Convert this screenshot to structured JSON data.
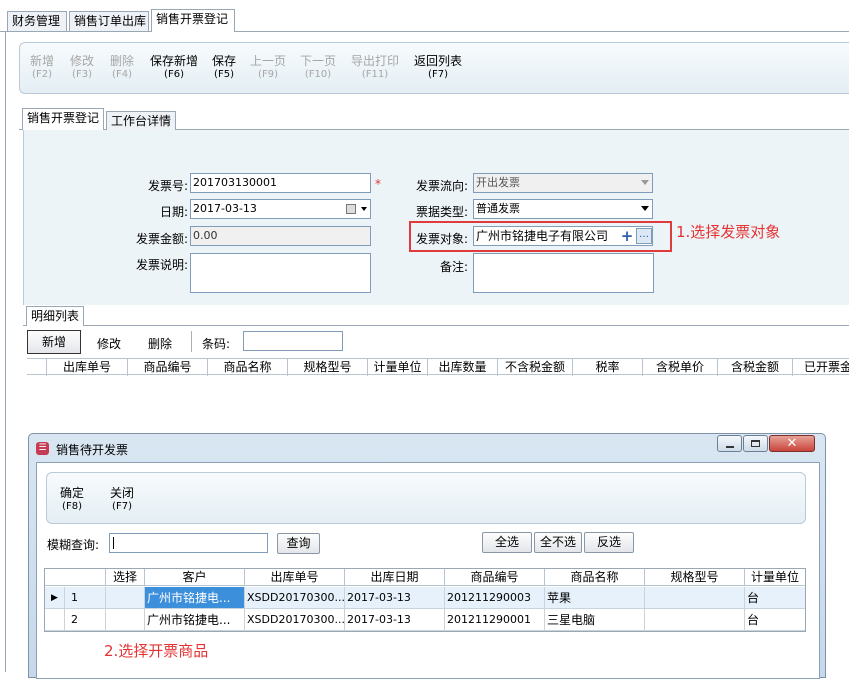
{
  "tabs": [
    "财务管理",
    "销售订单出库",
    "销售开票登记"
  ],
  "toolbar": [
    {
      "label": "新增",
      "key": "(F2)"
    },
    {
      "label": "修改",
      "key": "(F3)"
    },
    {
      "label": "删除",
      "key": "(F4)"
    },
    {
      "label": "保存新增",
      "key": "(F6)"
    },
    {
      "label": "保存",
      "key": "(F5)"
    },
    {
      "label": "上一页",
      "key": "(F9)"
    },
    {
      "label": "下一页",
      "key": "(F10)"
    },
    {
      "label": "导出打印",
      "key": "(F11)"
    },
    {
      "label": "返回列表",
      "key": "(F7)"
    }
  ],
  "subtabs": [
    "销售开票登记",
    "工作台详情"
  ],
  "form": {
    "invoice_no_label": "发票号:",
    "invoice_no": "201703130001",
    "required_mark": "*",
    "date_label": "日期:",
    "date": "2017-03-13",
    "amount_label": "发票金额:",
    "amount": "0.00",
    "desc_label": "发票说明:",
    "flow_label": "发票流向:",
    "flow": "开出发票",
    "type_label": "票据类型:",
    "type": "普通发票",
    "target_label": "发票对象:",
    "target": "广州市铭捷电子有限公司",
    "remark_label": "备注:"
  },
  "annotations": {
    "step1": "1.选择发票对象",
    "step2": "2.选择开票商品"
  },
  "detail": {
    "tab": "明细列表",
    "add": "新增",
    "edit": "修改",
    "delete": "删除",
    "barcode_label": "条码:",
    "columns": [
      "出库单号",
      "商品编号",
      "商品名称",
      "规格型号",
      "计量单位",
      "出库数量",
      "不含税金额",
      "税率",
      "含税单价",
      "含税金额",
      "已开票金"
    ]
  },
  "dialog": {
    "title": "销售待开发票",
    "confirm": "确定",
    "confirm_key": "(F8)",
    "close": "关闭",
    "close_key": "(F7)",
    "search_label": "模糊查询:",
    "search_button": "查询",
    "select_all": "全选",
    "select_none": "全不选",
    "invert": "反选",
    "columns": [
      "选择",
      "客户",
      "出库单号",
      "出库日期",
      "商品编号",
      "商品名称",
      "规格型号",
      "计量单位"
    ],
    "rows": [
      {
        "no": "1",
        "customer": "广州市铭捷电...",
        "order": "XSDD20170300...",
        "date": "2017-03-13",
        "code": "201211290003",
        "name": "苹果",
        "spec": "",
        "unit": "台"
      },
      {
        "no": "2",
        "customer": "广州市铭捷电...",
        "order": "XSDD20170300...",
        "date": "2017-03-13",
        "code": "201211290001",
        "name": "三星电脑",
        "spec": "",
        "unit": "台"
      }
    ]
  }
}
